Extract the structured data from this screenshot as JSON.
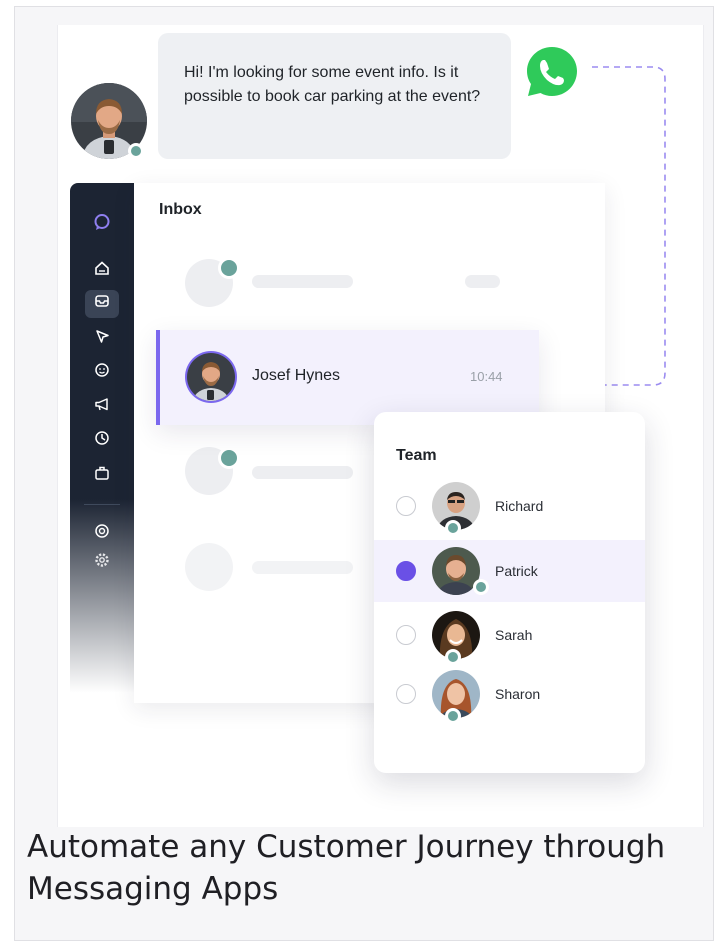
{
  "message": {
    "text": "Hi! I'm looking for some event info. Is it possible to book car parking at the event?"
  },
  "channel_icon": "whatsapp-icon",
  "sidebar": {
    "icons": [
      "logo-chat-icon",
      "home-icon",
      "inbox-icon",
      "cursor-icon",
      "chatbot-icon",
      "megaphone-icon",
      "analytics-icon",
      "briefcase-icon",
      "help-icon",
      "settings-icon"
    ]
  },
  "inbox": {
    "title": "Inbox",
    "selected": {
      "name": "Josef Hynes",
      "time": "10:44"
    }
  },
  "team": {
    "title": "Team",
    "members": [
      {
        "name": "Richard",
        "selected": false
      },
      {
        "name": "Patrick",
        "selected": true
      },
      {
        "name": "Sarah",
        "selected": false
      },
      {
        "name": "Sharon",
        "selected": false
      }
    ]
  },
  "caption": "Automate any Customer Journey through Messaging Apps",
  "colors": {
    "accent": "#6a50e6",
    "sidebar": "#1c2433",
    "status": "#6aa39b",
    "whatsapp": "#25d366"
  }
}
